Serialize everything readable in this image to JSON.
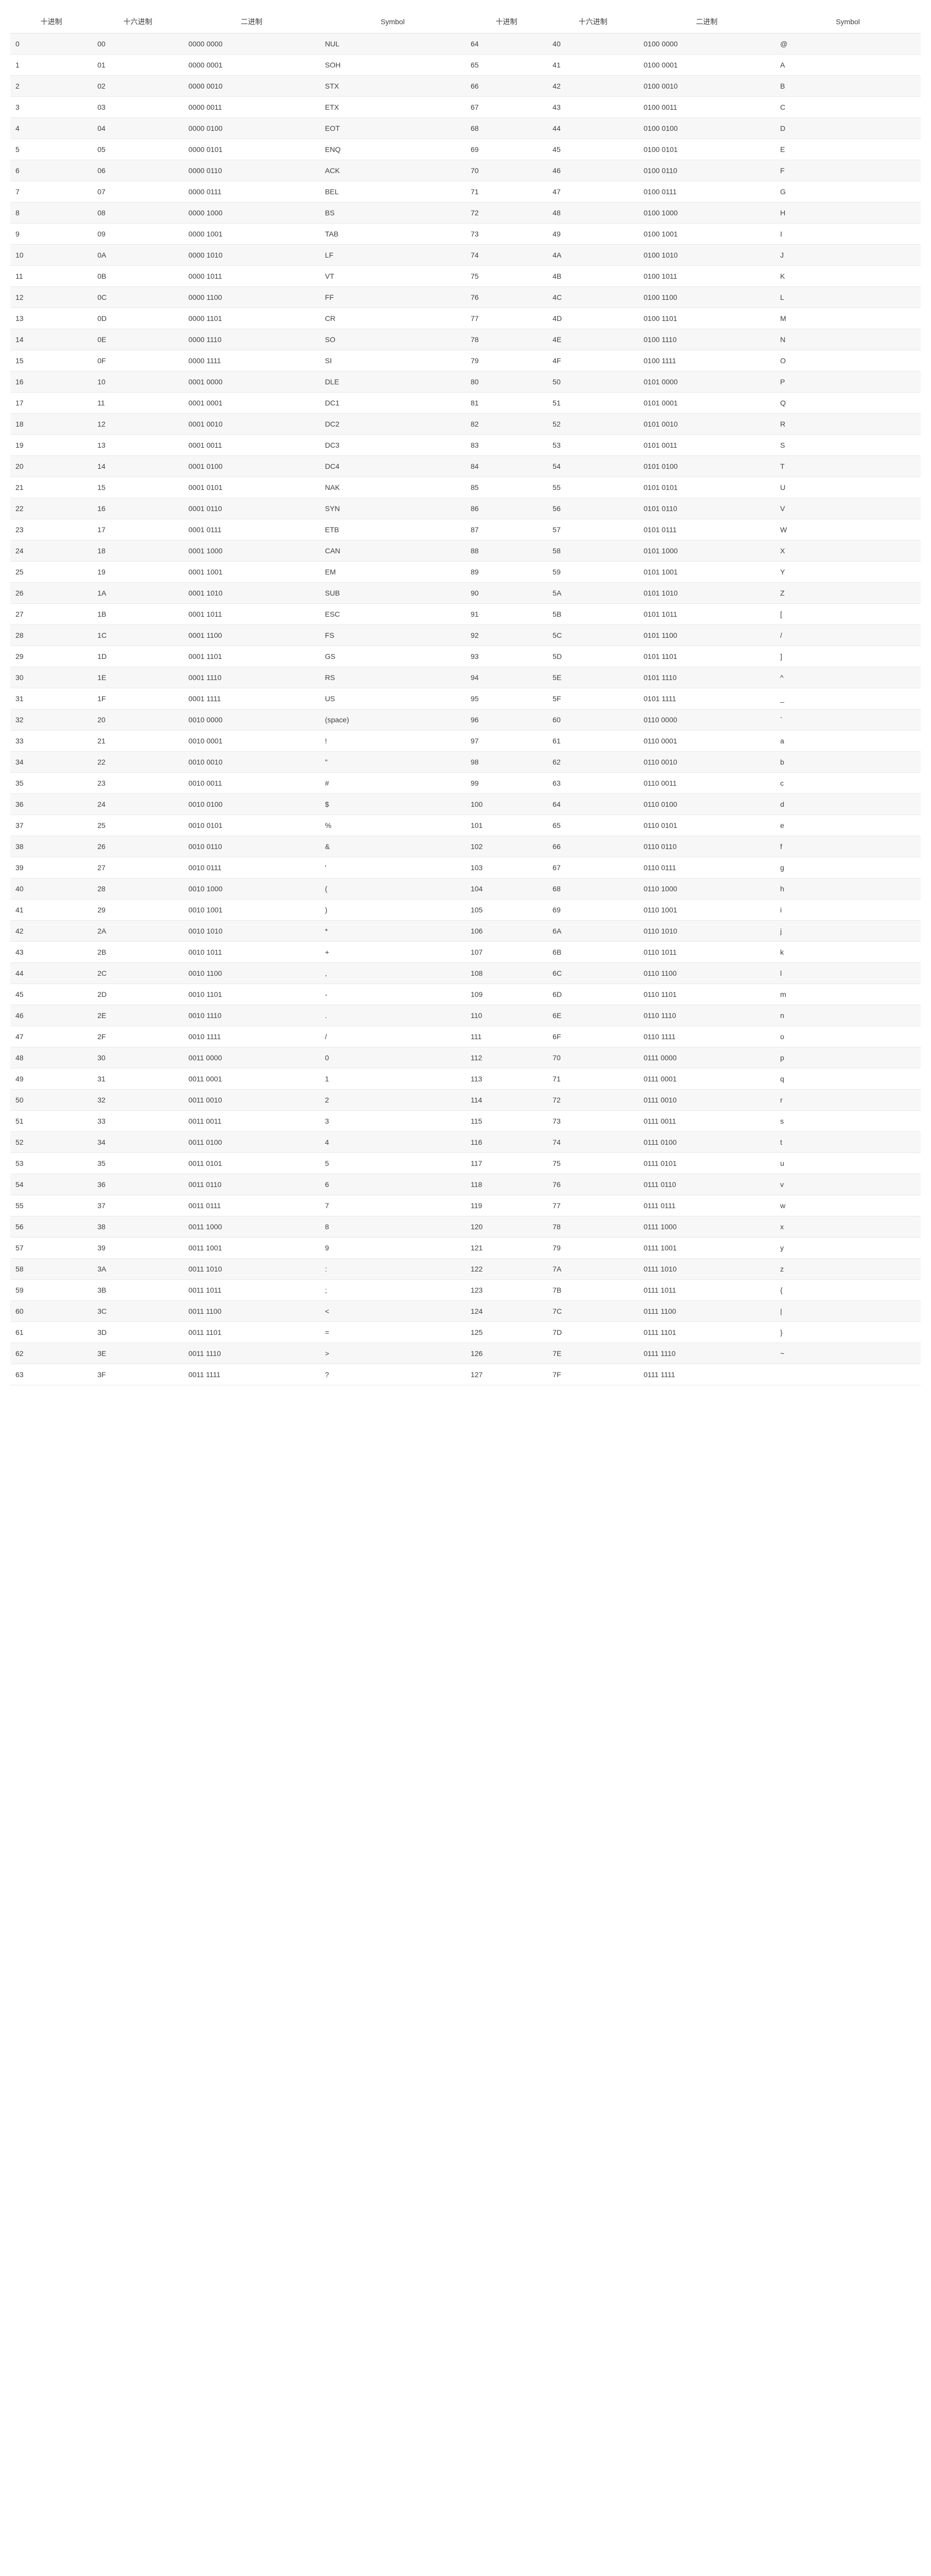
{
  "headers": [
    "十进制",
    "十六进制",
    "二进制",
    "Symbol",
    "十进制",
    "十六进制",
    "二进制",
    "Symbol"
  ],
  "rows": [
    [
      "0",
      "00",
      "0000 0000",
      "NUL",
      "64",
      "40",
      "0100 0000",
      "@"
    ],
    [
      "1",
      "01",
      "0000 0001",
      "SOH",
      "65",
      "41",
      "0100 0001",
      "A"
    ],
    [
      "2",
      "02",
      "0000 0010",
      "STX",
      "66",
      "42",
      "0100 0010",
      "B"
    ],
    [
      "3",
      "03",
      "0000 0011",
      "ETX",
      "67",
      "43",
      "0100 0011",
      "C"
    ],
    [
      "4",
      "04",
      "0000 0100",
      "EOT",
      "68",
      "44",
      "0100 0100",
      "D"
    ],
    [
      "5",
      "05",
      "0000 0101",
      "ENQ",
      "69",
      "45",
      "0100 0101",
      "E"
    ],
    [
      "6",
      "06",
      "0000 0110",
      "ACK",
      "70",
      "46",
      "0100 0110",
      "F"
    ],
    [
      "7",
      "07",
      "0000 0111",
      "BEL",
      "71",
      "47",
      "0100 0111",
      "G"
    ],
    [
      "8",
      "08",
      "0000 1000",
      "BS",
      "72",
      "48",
      "0100 1000",
      "H"
    ],
    [
      "9",
      "09",
      "0000 1001",
      "TAB",
      "73",
      "49",
      "0100 1001",
      "I"
    ],
    [
      "10",
      "0A",
      "0000 1010",
      "LF",
      "74",
      "4A",
      "0100 1010",
      "J"
    ],
    [
      "11",
      "0B",
      "0000 1011",
      "VT",
      "75",
      "4B",
      "0100 1011",
      "K"
    ],
    [
      "12",
      "0C",
      "0000 1100",
      "FF",
      "76",
      "4C",
      "0100 1100",
      "L"
    ],
    [
      "13",
      "0D",
      "0000 1101",
      "CR",
      "77",
      "4D",
      "0100 1101",
      "M"
    ],
    [
      "14",
      "0E",
      "0000 1110",
      "SO",
      "78",
      "4E",
      "0100 1110",
      "N"
    ],
    [
      "15",
      "0F",
      "0000 1111",
      "SI",
      "79",
      "4F",
      "0100 1111",
      "O"
    ],
    [
      "16",
      "10",
      "0001 0000",
      "DLE",
      "80",
      "50",
      "0101 0000",
      "P"
    ],
    [
      "17",
      "11",
      "0001 0001",
      "DC1",
      "81",
      "51",
      "0101 0001",
      "Q"
    ],
    [
      "18",
      "12",
      "0001 0010",
      "DC2",
      "82",
      "52",
      "0101 0010",
      "R"
    ],
    [
      "19",
      "13",
      "0001 0011",
      "DC3",
      "83",
      "53",
      "0101 0011",
      "S"
    ],
    [
      "20",
      "14",
      "0001 0100",
      "DC4",
      "84",
      "54",
      "0101 0100",
      "T"
    ],
    [
      "21",
      "15",
      "0001 0101",
      "NAK",
      "85",
      "55",
      "0101 0101",
      "U"
    ],
    [
      "22",
      "16",
      "0001 0110",
      "SYN",
      "86",
      "56",
      "0101 0110",
      "V"
    ],
    [
      "23",
      "17",
      "0001 0111",
      "ETB",
      "87",
      "57",
      "0101 0111",
      "W"
    ],
    [
      "24",
      "18",
      "0001 1000",
      "CAN",
      "88",
      "58",
      "0101 1000",
      "X"
    ],
    [
      "25",
      "19",
      "0001 1001",
      "EM",
      "89",
      "59",
      "0101 1001",
      "Y"
    ],
    [
      "26",
      "1A",
      "0001 1010",
      "SUB",
      "90",
      "5A",
      "0101 1010",
      "Z"
    ],
    [
      "27",
      "1B",
      "0001 1011",
      "ESC",
      "91",
      "5B",
      "0101 1011",
      "["
    ],
    [
      "28",
      "1C",
      "0001 1100",
      "FS",
      "92",
      "5C",
      "0101 1100",
      "/"
    ],
    [
      "29",
      "1D",
      "0001 1101",
      "GS",
      "93",
      "5D",
      "0101 1101",
      "]"
    ],
    [
      "30",
      "1E",
      "0001 1110",
      "RS",
      "94",
      "5E",
      "0101 1110",
      "^"
    ],
    [
      "31",
      "1F",
      "0001 1111",
      "US",
      "95",
      "5F",
      "0101 1111",
      "_"
    ],
    [
      "32",
      "20",
      "0010 0000",
      "(space)",
      "96",
      "60",
      "0110 0000",
      "`"
    ],
    [
      "33",
      "21",
      "0010 0001",
      "!",
      "97",
      "61",
      "0110 0001",
      "a"
    ],
    [
      "34",
      "22",
      "0010 0010",
      "\"",
      "98",
      "62",
      "0110 0010",
      "b"
    ],
    [
      "35",
      "23",
      "0010 0011",
      "#",
      "99",
      "63",
      "0110 0011",
      "c"
    ],
    [
      "36",
      "24",
      "0010 0100",
      "$",
      "100",
      "64",
      "0110 0100",
      "d"
    ],
    [
      "37",
      "25",
      "0010 0101",
      "%",
      "101",
      "65",
      "0110 0101",
      "e"
    ],
    [
      "38",
      "26",
      "0010 0110",
      "&",
      "102",
      "66",
      "0110 0110",
      "f"
    ],
    [
      "39",
      "27",
      "0010 0111",
      "'",
      "103",
      "67",
      "0110 0111",
      "g"
    ],
    [
      "40",
      "28",
      "0010 1000",
      "(",
      "104",
      "68",
      "0110 1000",
      "h"
    ],
    [
      "41",
      "29",
      "0010 1001",
      ")",
      "105",
      "69",
      "0110 1001",
      "i"
    ],
    [
      "42",
      "2A",
      "0010 1010",
      "*",
      "106",
      "6A",
      "0110 1010",
      "j"
    ],
    [
      "43",
      "2B",
      "0010 1011",
      "+",
      "107",
      "6B",
      "0110 1011",
      "k"
    ],
    [
      "44",
      "2C",
      "0010 1100",
      ",",
      "108",
      "6C",
      "0110 1100",
      "l"
    ],
    [
      "45",
      "2D",
      "0010 1101",
      "-",
      "109",
      "6D",
      "0110 1101",
      "m"
    ],
    [
      "46",
      "2E",
      "0010 1110",
      ".",
      "110",
      "6E",
      "0110 1110",
      "n"
    ],
    [
      "47",
      "2F",
      "0010 1111",
      "/",
      "111",
      "6F",
      "0110 1111",
      "o"
    ],
    [
      "48",
      "30",
      "0011 0000",
      "0",
      "112",
      "70",
      "0111 0000",
      "p"
    ],
    [
      "49",
      "31",
      "0011 0001",
      "1",
      "113",
      "71",
      "0111 0001",
      "q"
    ],
    [
      "50",
      "32",
      "0011 0010",
      "2",
      "114",
      "72",
      "0111 0010",
      "r"
    ],
    [
      "51",
      "33",
      "0011 0011",
      "3",
      "115",
      "73",
      "0111 0011",
      "s"
    ],
    [
      "52",
      "34",
      "0011 0100",
      "4",
      "116",
      "74",
      "0111 0100",
      "t"
    ],
    [
      "53",
      "35",
      "0011 0101",
      "5",
      "117",
      "75",
      "0111 0101",
      "u"
    ],
    [
      "54",
      "36",
      "0011 0110",
      "6",
      "118",
      "76",
      "0111 0110",
      "v"
    ],
    [
      "55",
      "37",
      "0011 0111",
      "7",
      "119",
      "77",
      "0111 0111",
      "w"
    ],
    [
      "56",
      "38",
      "0011 1000",
      "8",
      "120",
      "78",
      "0111 1000",
      "x"
    ],
    [
      "57",
      "39",
      "0011 1001",
      "9",
      "121",
      "79",
      "0111 1001",
      "y"
    ],
    [
      "58",
      "3A",
      "0011 1010",
      ":",
      "122",
      "7A",
      "0111 1010",
      "z"
    ],
    [
      "59",
      "3B",
      "0011 1011",
      ";",
      "123",
      "7B",
      "0111 1011",
      "{"
    ],
    [
      "60",
      "3C",
      "0011 1100",
      "<",
      "124",
      "7C",
      "0111 1100",
      "|"
    ],
    [
      "61",
      "3D",
      "0011 1101",
      "=",
      "125",
      "7D",
      "0111 1101",
      "}"
    ],
    [
      "62",
      "3E",
      "0011 1110",
      ">",
      "126",
      "7E",
      "0111 1110",
      "~"
    ],
    [
      "63",
      "3F",
      "0011 1111",
      "?",
      "127",
      "7F",
      "0111 1111",
      ""
    ]
  ]
}
